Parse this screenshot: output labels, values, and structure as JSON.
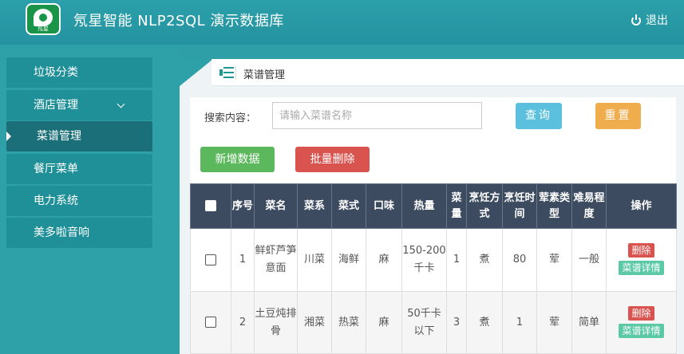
{
  "header": {
    "logo_text": "氖星",
    "title": "氖星智能 NLP2SQL 演示数据库",
    "logout_label": "退出"
  },
  "sidebar": {
    "items": [
      {
        "label": "垃圾分类"
      },
      {
        "label": "酒店管理"
      },
      {
        "label": "菜谱管理"
      },
      {
        "label": "餐厅菜单"
      },
      {
        "label": "电力系统"
      },
      {
        "label": "美多啦音响"
      }
    ],
    "active_index": 2
  },
  "tab": {
    "label": "菜谱管理"
  },
  "search": {
    "label": "搜索内容：",
    "placeholder": "请输入菜谱名称",
    "value": "",
    "query_label": "查询",
    "reset_label": "重置"
  },
  "actions": {
    "add_label": "新增数据",
    "batch_delete_label": "批量删除"
  },
  "table": {
    "columns": [
      "序号",
      "菜名",
      "菜系",
      "菜式",
      "口味",
      "热量",
      "菜量",
      "烹饪方式",
      "烹饪时间",
      "荤素类型",
      "难易程度",
      "操作"
    ],
    "rows": [
      {
        "id": "1",
        "name": "鲜虾芦笋意面",
        "cuisine": "川菜",
        "style": "海鲜",
        "taste": "麻",
        "calories": "150-200千卡",
        "portion": "1",
        "method": "煮",
        "time": "80",
        "type": "荤",
        "difficulty": "一般"
      },
      {
        "id": "2",
        "name": "土豆炖排骨",
        "cuisine": "湘菜",
        "style": "热菜",
        "taste": "麻",
        "calories": "50千卡以下",
        "portion": "3",
        "method": "煮",
        "time": "1",
        "type": "荤",
        "difficulty": "简单"
      }
    ],
    "delete_label": "删除",
    "detail_label": "菜谱详情"
  },
  "colors": {
    "header_bg": "#2592a0",
    "sidebar_item": "#1f8f98",
    "sidebar_active": "#1a6f78",
    "table_header": "#3d4b60",
    "query": "#5bc0de",
    "reset": "#f0ad4e",
    "add": "#5cb85c",
    "delete": "#d9534f",
    "detail": "#5bc8a6"
  }
}
